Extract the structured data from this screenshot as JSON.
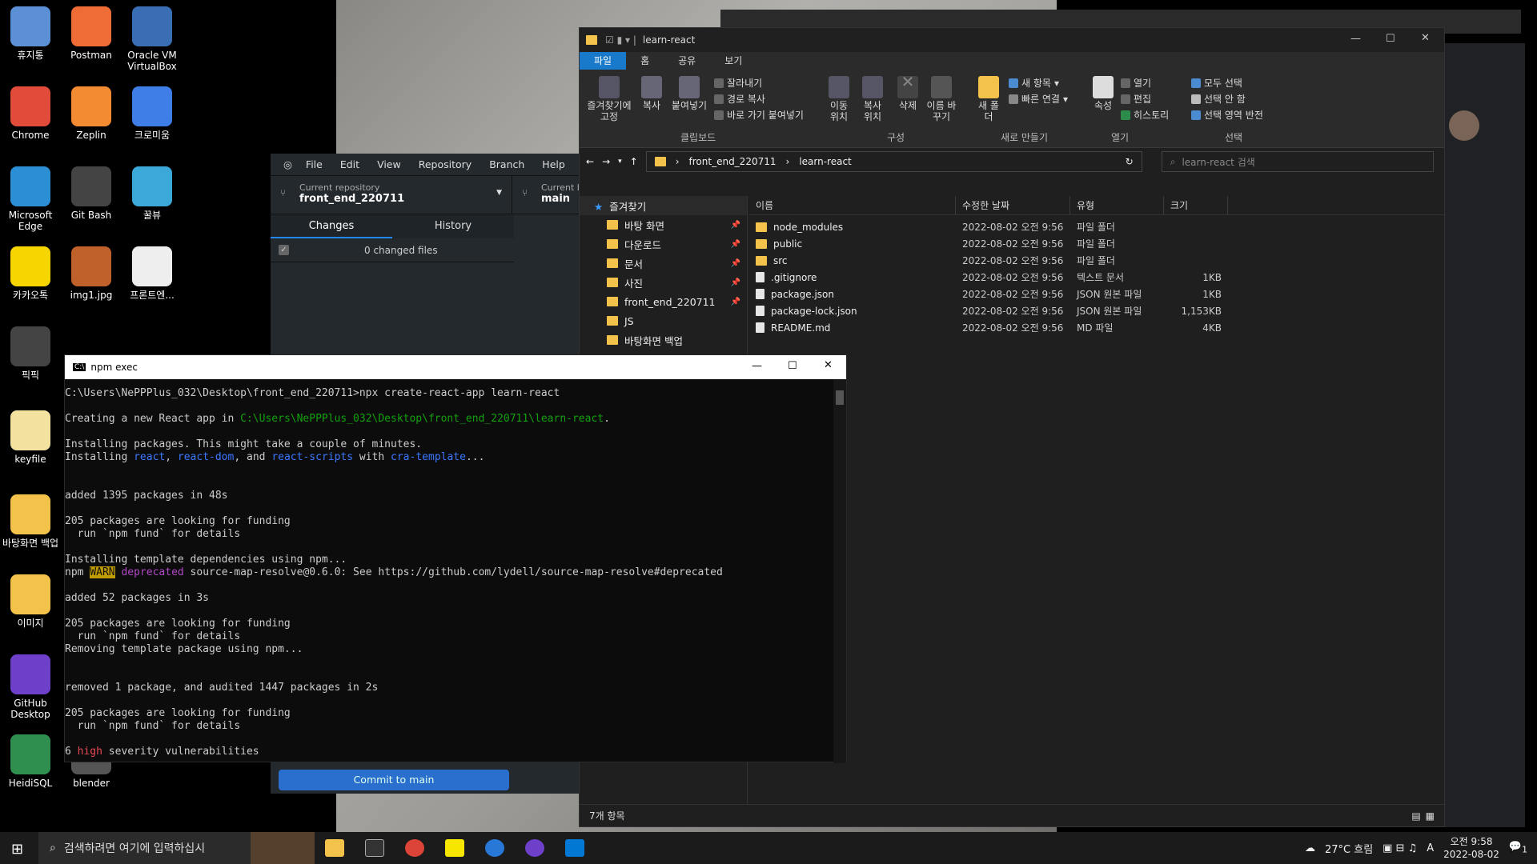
{
  "desktop_icons": [
    {
      "label": "휴지통"
    },
    {
      "label": "Postman"
    },
    {
      "label": "Oracle VM VirtualBox"
    },
    {
      "label": "Chrome"
    },
    {
      "label": "Zeplin"
    },
    {
      "label": "크로미움"
    },
    {
      "label": "Microsoft Edge"
    },
    {
      "label": "Git Bash"
    },
    {
      "label": "꿀뷰"
    },
    {
      "label": "카카오톡"
    },
    {
      "label": "img1.jpg"
    },
    {
      "label": "프론트엔..."
    },
    {
      "label": "픽픽"
    },
    {
      "label": "keyfile"
    },
    {
      "label": "바탕화면 백업"
    },
    {
      "label": "이미지"
    },
    {
      "label": "GitHub Desktop"
    },
    {
      "label": "HeidiSQL"
    },
    {
      "label": "blender"
    }
  ],
  "github": {
    "menu": [
      "File",
      "Edit",
      "View",
      "Repository",
      "Branch",
      "Help"
    ],
    "current_repo_label": "Current repository",
    "current_repo": "front_end_220711",
    "current_branch_label": "Current b",
    "current_branch": "main",
    "tabs": [
      "Changes",
      "History"
    ],
    "changed_files": "0 changed files",
    "commit_button": "Commit to main"
  },
  "explorer": {
    "title": "learn-react",
    "ribbon_tabs": [
      "파일",
      "홈",
      "공유",
      "보기"
    ],
    "ribbon": {
      "pin": "즐겨찾기에 고정",
      "copy": "복사",
      "paste": "붙여넣기",
      "cut": "잘라내기",
      "copy_path": "경로 복사",
      "paste_shortcut": "바로 가기 붙여넣기",
      "clipboard": "클립보드",
      "move_to": "이동 위치",
      "copy_to": "복사 위치",
      "delete": "삭제",
      "rename": "이름 바꾸기",
      "organize": "구성",
      "new_folder": "새 폴더",
      "new_item": "새 항목",
      "easy_access": "빠른 연결",
      "new": "새로 만들기",
      "properties": "속성",
      "open": "열기",
      "edit": "편집",
      "history": "히스토리",
      "open_group": "열기",
      "select_all": "모두 선택",
      "select_none": "선택 안 함",
      "invert": "선택 영역 반전",
      "select": "선택"
    },
    "path": [
      "front_end_220711",
      "learn-react"
    ],
    "search_placeholder": "learn-react 검색",
    "nav": [
      {
        "label": "즐겨찾기",
        "pin": false
      },
      {
        "label": "바탕 화면",
        "pin": true
      },
      {
        "label": "다운로드",
        "pin": true
      },
      {
        "label": "문서",
        "pin": true
      },
      {
        "label": "사진",
        "pin": true
      },
      {
        "label": "front_end_220711",
        "pin": true
      },
      {
        "label": "JS",
        "pin": false
      },
      {
        "label": "바탕화면 백업",
        "pin": false
      }
    ],
    "columns": [
      "이름",
      "수정한 날짜",
      "유형",
      "크기"
    ],
    "files": [
      {
        "name": "node_modules",
        "date": "2022-08-02 오전 9:56",
        "type": "파일 폴더",
        "size": "",
        "kind": "folder"
      },
      {
        "name": "public",
        "date": "2022-08-02 오전 9:56",
        "type": "파일 폴더",
        "size": "",
        "kind": "folder"
      },
      {
        "name": "src",
        "date": "2022-08-02 오전 9:56",
        "type": "파일 폴더",
        "size": "",
        "kind": "folder"
      },
      {
        "name": ".gitignore",
        "date": "2022-08-02 오전 9:56",
        "type": "텍스트 문서",
        "size": "1KB",
        "kind": "file"
      },
      {
        "name": "package.json",
        "date": "2022-08-02 오전 9:56",
        "type": "JSON 원본 파일",
        "size": "1KB",
        "kind": "file"
      },
      {
        "name": "package-lock.json",
        "date": "2022-08-02 오전 9:56",
        "type": "JSON 원본 파일",
        "size": "1,153KB",
        "kind": "file"
      },
      {
        "name": "README.md",
        "date": "2022-08-02 오전 9:56",
        "type": "MD 파일",
        "size": "4KB",
        "kind": "file"
      }
    ],
    "status": "7개 항목"
  },
  "terminal": {
    "title": "npm exec",
    "lines": [
      {
        "t": "C:\\Users\\NePPPlus_032\\Desktop\\front_end_220711>npx create-react-app learn-react"
      },
      {
        "t": ""
      },
      {
        "parts": [
          {
            "t": "Creating a new React app in "
          },
          {
            "t": "C:\\Users\\NePPPlus_032\\Desktop\\front_end_220711\\learn-react",
            "c": "g"
          },
          {
            "t": "."
          }
        ]
      },
      {
        "t": ""
      },
      {
        "t": "Installing packages. This might take a couple of minutes."
      },
      {
        "parts": [
          {
            "t": "Installing "
          },
          {
            "t": "react",
            "c": "b"
          },
          {
            "t": ", "
          },
          {
            "t": "react-dom",
            "c": "b"
          },
          {
            "t": ", and "
          },
          {
            "t": "react-scripts",
            "c": "b"
          },
          {
            "t": " with "
          },
          {
            "t": "cra-template",
            "c": "b"
          },
          {
            "t": "..."
          }
        ]
      },
      {
        "t": ""
      },
      {
        "t": ""
      },
      {
        "t": "added 1395 packages in 48s"
      },
      {
        "t": ""
      },
      {
        "t": "205 packages are looking for funding"
      },
      {
        "t": "  run `npm fund` for details"
      },
      {
        "t": ""
      },
      {
        "t": "Installing template dependencies using npm..."
      },
      {
        "parts": [
          {
            "t": "npm "
          },
          {
            "t": "WARN",
            "c": "warn"
          },
          {
            "t": " "
          },
          {
            "t": "deprecated",
            "c": "m"
          },
          {
            "t": " source-map-resolve@0.6.0: See https://github.com/lydell/source-map-resolve#deprecated"
          }
        ]
      },
      {
        "t": ""
      },
      {
        "t": "added 52 packages in 3s"
      },
      {
        "t": ""
      },
      {
        "t": "205 packages are looking for funding"
      },
      {
        "t": "  run `npm fund` for details"
      },
      {
        "t": "Removing template package using npm..."
      },
      {
        "t": ""
      },
      {
        "t": ""
      },
      {
        "t": "removed 1 package, and audited 1447 packages in 2s"
      },
      {
        "t": ""
      },
      {
        "t": "205 packages are looking for funding"
      },
      {
        "t": "  run `npm fund` for details"
      },
      {
        "t": ""
      },
      {
        "parts": [
          {
            "t": "6 "
          },
          {
            "t": "high",
            "c": "r"
          },
          {
            "t": " severity vulnerabilities"
          }
        ]
      }
    ]
  },
  "taskbar": {
    "search_placeholder": "검색하려면 여기에 입력하십시",
    "weather": "27°C 흐림",
    "ime": "A",
    "time": "오전 9:58",
    "date": "2022-08-02",
    "notification": "1"
  }
}
